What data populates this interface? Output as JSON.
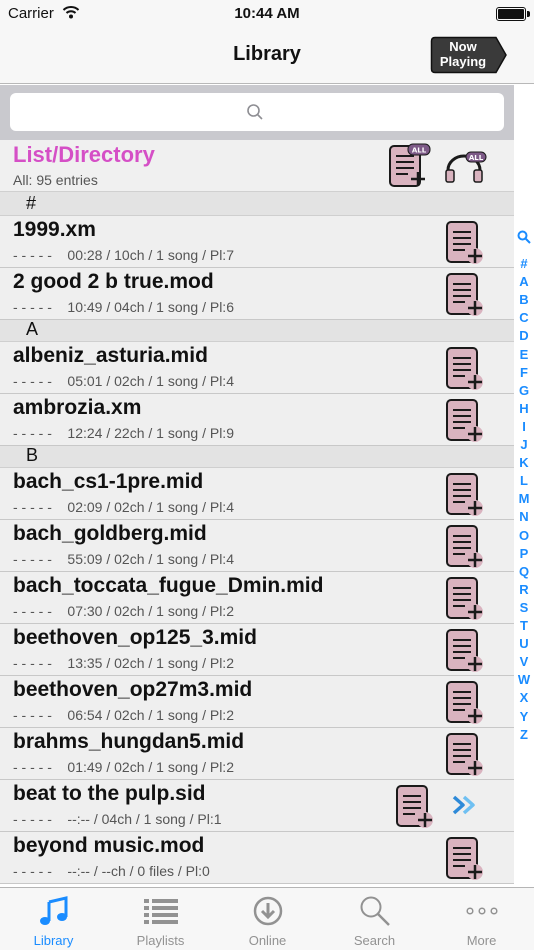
{
  "status": {
    "carrier": "Carrier",
    "time": "10:44 AM"
  },
  "nav": {
    "title": "Library",
    "now_playing_line1": "Now",
    "now_playing_line2": "Playing"
  },
  "list": {
    "title": "List/Directory",
    "entries": "All: 95 entries"
  },
  "sections": [
    "#",
    "A",
    "B"
  ],
  "rows": [
    {
      "name": "1999.xm",
      "info": "- - - - -    00:28 / 10ch / 1 song / Pl:7"
    },
    {
      "name": "2 good 2 b true.mod",
      "info": "- - - - -    10:49 / 04ch / 1 song / Pl:6"
    },
    {
      "name": "albeniz_asturia.mid",
      "info": "- - - - -    05:01 / 02ch / 1 song / Pl:4"
    },
    {
      "name": "ambrozia.xm",
      "info": "- - - - -    12:24 / 22ch / 1 song / Pl:9"
    },
    {
      "name": "bach_cs1-1pre.mid",
      "info": "- - - - -    02:09 / 02ch / 1 song / Pl:4"
    },
    {
      "name": "bach_goldberg.mid",
      "info": "- - - - -    55:09 / 02ch / 1 song / Pl:4"
    },
    {
      "name": "bach_toccata_fugue_Dmin.mid",
      "info": "- - - - -    07:30 / 02ch / 1 song / Pl:2"
    },
    {
      "name": "beethoven_op125_3.mid",
      "info": "- - - - -    13:35 / 02ch / 1 song / Pl:2"
    },
    {
      "name": "beethoven_op27m3.mid",
      "info": "- - - - -    06:54 / 02ch / 1 song / Pl:2"
    },
    {
      "name": "brahms_hungdan5.mid",
      "info": "- - - - -    01:49 / 02ch / 1 song / Pl:2"
    },
    {
      "name": "beat to the pulp.sid",
      "info": "- - - - -    --:-- / 04ch / 1 song / Pl:1"
    },
    {
      "name": "beyond music.mod",
      "info": "- - - - -    --:-- / --ch / 0 files / Pl:0"
    }
  ],
  "index": [
    "#",
    "A",
    "B",
    "C",
    "D",
    "E",
    "F",
    "G",
    "H",
    "I",
    "J",
    "K",
    "L",
    "M",
    "N",
    "O",
    "P",
    "Q",
    "R",
    "S",
    "T",
    "U",
    "V",
    "W",
    "X",
    "Y",
    "Z"
  ],
  "icons": {
    "add_playlist": "playlist-add-icon",
    "add_all": "add-all-icon",
    "headphones_all": "headphones-all-icon",
    "expand": "double-chevron-icon",
    "index_search": "search-icon"
  },
  "colors": {
    "accent": "#1a8cff",
    "list_title": "#d54fc6",
    "icon_fill": "#d9b3bf"
  },
  "tabs": [
    {
      "label": "Library",
      "active": true
    },
    {
      "label": "Playlists"
    },
    {
      "label": "Online"
    },
    {
      "label": "Search"
    },
    {
      "label": "More"
    }
  ]
}
